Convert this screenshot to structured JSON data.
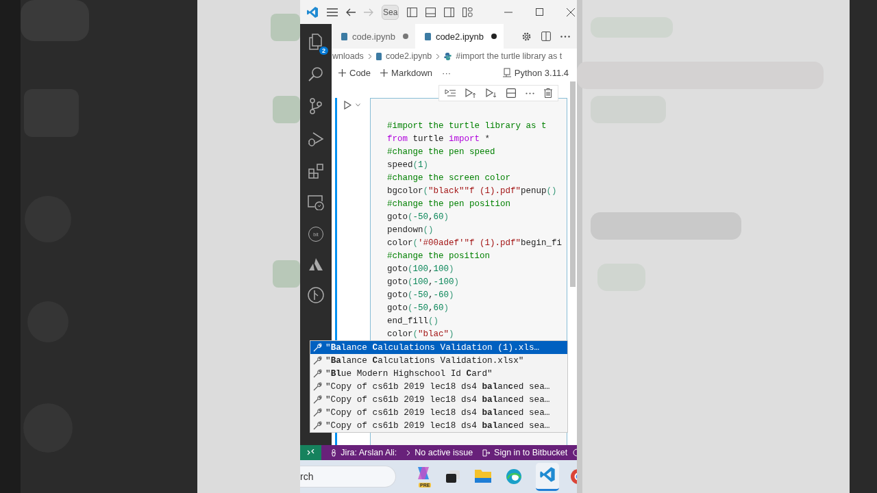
{
  "title_bar": {
    "search": "Sea"
  },
  "activity_bar": {
    "explorer_badge": "2",
    "bit_label": "bit"
  },
  "tabs": [
    {
      "label": "code.ipynb",
      "selected": false,
      "dirty": true
    },
    {
      "label": "code2.ipynb",
      "selected": true,
      "dirty": true
    }
  ],
  "breadcrumb": [
    "wnloads",
    "code2.ipynb",
    "#import the turtle library as t"
  ],
  "notebook_toolbar": {
    "add_code": "Code",
    "add_markdown": "Markdown",
    "more": "···",
    "kernel": "Python 3.11.4"
  },
  "cell": {
    "lines": [
      [
        {
          "kind": "comment",
          "text": "#import the turtle library as t"
        }
      ],
      [
        {
          "kind": "keyword",
          "text": "from"
        },
        {
          "kind": "plain",
          "text": " turtle "
        },
        {
          "kind": "keyword",
          "text": "import"
        },
        {
          "kind": "plain",
          "text": " *"
        }
      ],
      [
        {
          "kind": "comment",
          "text": "#change the pen speed"
        }
      ],
      [
        {
          "kind": "plain",
          "text": "speed"
        },
        {
          "kind": "punct",
          "text": "("
        },
        {
          "kind": "number",
          "text": "1"
        },
        {
          "kind": "punct",
          "text": ")"
        }
      ],
      [
        {
          "kind": "comment",
          "text": "#change the screen color"
        }
      ],
      [
        {
          "kind": "plain",
          "text": "bgcolor"
        },
        {
          "kind": "punct",
          "text": "("
        },
        {
          "kind": "string",
          "text": "\"black\"\"f (1).pdf\""
        },
        {
          "kind": "plain",
          "text": "penup"
        },
        {
          "kind": "punct",
          "text": "()"
        }
      ],
      [
        {
          "kind": "comment",
          "text": "#change the pen position"
        }
      ],
      [
        {
          "kind": "plain",
          "text": "goto"
        },
        {
          "kind": "punct",
          "text": "("
        },
        {
          "kind": "number",
          "text": "-50"
        },
        {
          "kind": "plain",
          "text": ","
        },
        {
          "kind": "number",
          "text": "60"
        },
        {
          "kind": "punct",
          "text": ")"
        }
      ],
      [
        {
          "kind": "plain",
          "text": "pendown"
        },
        {
          "kind": "punct",
          "text": "()"
        }
      ],
      [
        {
          "kind": "plain",
          "text": "color"
        },
        {
          "kind": "punct",
          "text": "("
        },
        {
          "kind": "string",
          "text": "'#00adef'\"f (1).pdf\""
        },
        {
          "kind": "plain",
          "text": "begin_fi"
        }
      ],
      [
        {
          "kind": "comment",
          "text": "#change the position"
        }
      ],
      [
        {
          "kind": "plain",
          "text": "goto"
        },
        {
          "kind": "punct",
          "text": "("
        },
        {
          "kind": "number",
          "text": "100"
        },
        {
          "kind": "plain",
          "text": ","
        },
        {
          "kind": "number",
          "text": "100"
        },
        {
          "kind": "punct",
          "text": ")"
        }
      ],
      [
        {
          "kind": "plain",
          "text": "goto"
        },
        {
          "kind": "punct",
          "text": "("
        },
        {
          "kind": "number",
          "text": "100"
        },
        {
          "kind": "plain",
          "text": ","
        },
        {
          "kind": "number",
          "text": "-100"
        },
        {
          "kind": "punct",
          "text": ")"
        }
      ],
      [
        {
          "kind": "plain",
          "text": "goto"
        },
        {
          "kind": "punct",
          "text": "("
        },
        {
          "kind": "number",
          "text": "-50"
        },
        {
          "kind": "plain",
          "text": ","
        },
        {
          "kind": "number",
          "text": "-60"
        },
        {
          "kind": "punct",
          "text": ")"
        }
      ],
      [
        {
          "kind": "plain",
          "text": "goto"
        },
        {
          "kind": "punct",
          "text": "("
        },
        {
          "kind": "number",
          "text": "-50"
        },
        {
          "kind": "plain",
          "text": ","
        },
        {
          "kind": "number",
          "text": "60"
        },
        {
          "kind": "punct",
          "text": ")"
        }
      ],
      [
        {
          "kind": "plain",
          "text": "end_fill"
        },
        {
          "kind": "punct",
          "text": "()"
        }
      ],
      [
        {
          "kind": "plain",
          "text": "color"
        },
        {
          "kind": "punct",
          "text": "("
        },
        {
          "kind": "string",
          "text": "\"blac\""
        },
        {
          "kind": "punct",
          "text": ")"
        }
      ]
    ]
  },
  "suggestions": [
    {
      "text": "\"**Ba**lance **C**alculations Validation (1).xls…",
      "selected": true
    },
    {
      "text": "\"**Ba**lance **C**alculations Validation.xlsx\"",
      "selected": false
    },
    {
      "text": "\"**Bl**ue Modern Highschool Id **C**ard\"",
      "selected": false
    },
    {
      "text": "\"Copy of cs61b 2019 lec18 ds4 **bal**an**c**ed sea…",
      "selected": false
    },
    {
      "text": "\"Copy of cs61b 2019 lec18 ds4 **bal**an**c**ed sea…",
      "selected": false
    },
    {
      "text": "\"Copy of cs61b 2019 lec18 ds4 **bal**an**c**ed sea…",
      "selected": false
    },
    {
      "text": "\"Copy of cs61b 2019 lec18 ds4 **bal**an**c**ed sea…",
      "selected": false
    }
  ],
  "status_bar": {
    "jira": "Jira: Arslan Ali:",
    "issue": "No active issue",
    "bitbucket": "Sign in to Bitbucket"
  },
  "taskbar": {
    "search": "rch",
    "copilot_badge": "PRE"
  }
}
